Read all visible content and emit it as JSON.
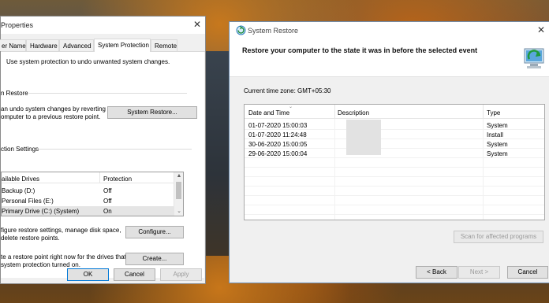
{
  "properties_window": {
    "title": "Properties",
    "tabs": [
      {
        "label": "er Name"
      },
      {
        "label": "Hardware"
      },
      {
        "label": "Advanced"
      },
      {
        "label": "System Protection"
      },
      {
        "label": "Remote"
      }
    ],
    "intro": "Use system protection to undo unwanted system changes.",
    "restore_group": {
      "heading": "n Restore",
      "line1": "an undo system changes by reverting",
      "line2": "omputer to a previous restore point.",
      "button": "System Restore..."
    },
    "protection_group": {
      "heading": "ction Settings",
      "columns": [
        "ailable Drives",
        "Protection"
      ],
      "drives": [
        {
          "name": "Backup (D:)",
          "protection": "Off"
        },
        {
          "name": "Personal Files (E:)",
          "protection": "Off"
        },
        {
          "name": "Primary Drive (C:) (System)",
          "protection": "On"
        }
      ],
      "configure_line1": "figure restore settings, manage disk space,",
      "configure_line2": "delete restore points.",
      "configure_button": "Configure...",
      "create_line1": "te a restore point right now for the drives that",
      "create_line2": "system protection turned on.",
      "create_button": "Create..."
    },
    "buttons": {
      "ok": "OK",
      "cancel": "Cancel",
      "apply": "Apply"
    }
  },
  "restore_window": {
    "title": "System Restore",
    "heading": "Restore your computer to the state it was in before the selected event",
    "timezone": "Current time zone: GMT+05:30",
    "columns": [
      "Date and Time",
      "Description",
      "Type"
    ],
    "rows": [
      {
        "date": "01-07-2020 15:00:03",
        "type": "System"
      },
      {
        "date": "01-07-2020 11:24:48",
        "type": "Install"
      },
      {
        "date": "30-06-2020 15:00:05",
        "type": "System"
      },
      {
        "date": "29-06-2020 15:00:04",
        "type": "System"
      }
    ],
    "scan_button": "Scan for affected programs",
    "back_button": "< Back",
    "next_button": "Next >",
    "cancel_button": "Cancel"
  }
}
